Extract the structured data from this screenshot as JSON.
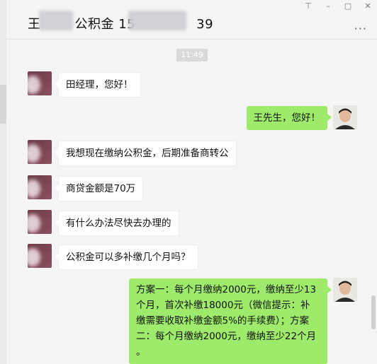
{
  "window": {
    "title_prefix": "王",
    "title_mid": "公积金 15",
    "title_suffix": "39",
    "controls": [
      "⊤",
      "–",
      "▢",
      "✕"
    ],
    "more_label": "···"
  },
  "timestamp": "11:49",
  "messages": [
    {
      "side": "left",
      "lines": [
        "田经理，您好！"
      ]
    },
    {
      "side": "right",
      "lines": [
        "王先生，您好！"
      ]
    },
    {
      "side": "left",
      "lines": [
        "我想现在缴纳公积金，后期准备商转公"
      ]
    },
    {
      "side": "left",
      "lines": [
        "商贷金额是70万"
      ]
    },
    {
      "side": "left",
      "lines": [
        "有什么办法尽快去办理的"
      ]
    },
    {
      "side": "left",
      "lines": [
        "公积金可以多补缴几个月吗？"
      ]
    },
    {
      "side": "right",
      "lines": [
        "方案一：每个月缴纳2000元，缴纳至少13",
        "个月，首次补缴18000元（微信提示：补",
        "缴需要收取补缴金额5%的手续费）；方案",
        "二：每个月缴纳2000元，缴纳至少22个月",
        "。"
      ]
    }
  ],
  "colors": {
    "sent_bubble": "#9eea6a",
    "received_bubble": "#ffffff",
    "background": "#f5f5f5"
  }
}
